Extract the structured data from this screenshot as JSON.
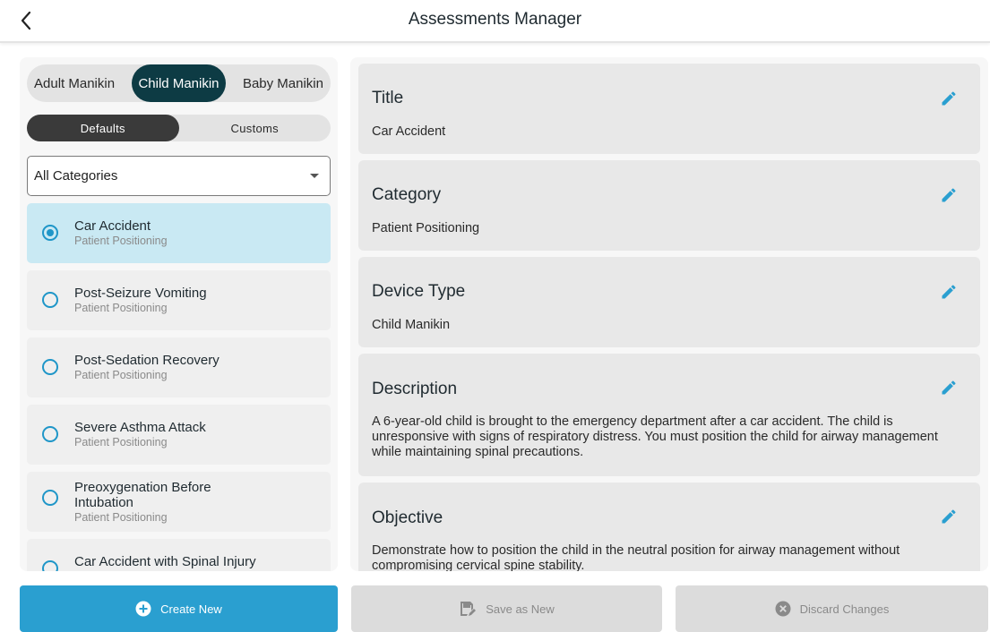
{
  "header": {
    "title": "Assessments Manager",
    "back_icon": "chevron-left-icon"
  },
  "left": {
    "manikin_tabs": [
      {
        "label": "Adult Manikin",
        "active": false
      },
      {
        "label": "Child Manikin",
        "active": true
      },
      {
        "label": "Baby Manikin",
        "active": false
      }
    ],
    "type_tabs": [
      {
        "label": "Defaults",
        "active": true
      },
      {
        "label": "Customs",
        "active": false
      }
    ],
    "category_select": {
      "value": "All Categories"
    },
    "items": [
      {
        "title": "Car Accident",
        "category": "Patient Positioning",
        "selected": true
      },
      {
        "title": "Post-Seizure Vomiting",
        "category": "Patient Positioning",
        "selected": false
      },
      {
        "title": "Post-Sedation Recovery",
        "category": "Patient Positioning",
        "selected": false
      },
      {
        "title": "Severe Asthma Attack",
        "category": "Patient Positioning",
        "selected": false
      },
      {
        "title": "Preoxygenation Before Intubation",
        "category": "Patient Positioning",
        "selected": false
      },
      {
        "title": "Car Accident with Spinal Injury",
        "category": "",
        "selected": false
      }
    ]
  },
  "details": {
    "title": {
      "label": "Title",
      "value": "Car Accident"
    },
    "category": {
      "label": "Category",
      "value": "Patient Positioning"
    },
    "device_type": {
      "label": "Device Type",
      "value": "Child Manikin"
    },
    "description": {
      "label": "Description",
      "value": "A 6-year-old child is brought to the emergency department after a car accident. The child is unresponsive with signs of respiratory distress. You must position the child for airway management while maintaining spinal precautions."
    },
    "objective": {
      "label": "Objective",
      "value": "Demonstrate how to position the child in the neutral position for airway management without compromising cervical spine stability."
    }
  },
  "actions": {
    "create_label": "Create New",
    "save_label": "Save as New",
    "discard_label": "Discard Changes"
  },
  "colors": {
    "accent": "#2a9fd0",
    "active_segment": "#0d3b44",
    "selected_row": "#c9e9f3",
    "edit_icon": "#2a9fd0"
  }
}
